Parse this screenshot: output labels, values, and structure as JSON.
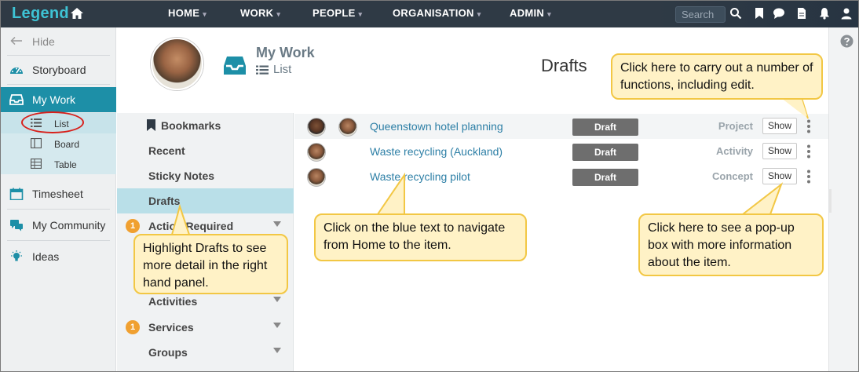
{
  "app": {
    "logo": "Legend"
  },
  "nav": {
    "items": [
      {
        "label": "HOME",
        "caret": "▾"
      },
      {
        "label": "WORK",
        "caret": "▾"
      },
      {
        "label": "PEOPLE",
        "caret": "▾"
      },
      {
        "label": "ORGANISATION",
        "caret": "▾"
      },
      {
        "label": "ADMIN",
        "caret": "▾"
      }
    ],
    "search_placeholder": "Search",
    "icons": [
      "search-icon",
      "bookmark-icon",
      "chat-icon",
      "document-icon",
      "bell-icon",
      "user-icon"
    ]
  },
  "sidebar": {
    "hide": "Hide",
    "items": [
      {
        "label": "Storyboard",
        "icon": "dashboard-icon"
      },
      {
        "label": "My Work",
        "icon": "inbox-icon"
      },
      {
        "label": "Timesheet",
        "icon": "calendar-icon"
      },
      {
        "label": "My Community",
        "icon": "chat-icon"
      },
      {
        "label": "Ideas",
        "icon": "lightbulb-icon"
      }
    ],
    "sub_items": [
      {
        "label": "List",
        "icon": "list-icon"
      },
      {
        "label": "Board",
        "icon": "board-icon"
      },
      {
        "label": "Table",
        "icon": "table-icon"
      }
    ]
  },
  "header": {
    "title": "My Work",
    "view": "List",
    "page_title": "Drafts"
  },
  "mid_menu": {
    "items": [
      {
        "label": "Bookmarks"
      },
      {
        "label": "Recent"
      },
      {
        "label": "Sticky Notes"
      },
      {
        "label": "Drafts"
      },
      {
        "label": "Action Required",
        "badge": "1"
      },
      {
        "label": "Activities"
      },
      {
        "label": "Services",
        "badge": "1"
      },
      {
        "label": "Groups"
      }
    ]
  },
  "drafts": {
    "rows": [
      {
        "title": "Queenstown hotel planning",
        "status": "Draft",
        "type": "Project",
        "show": "Show"
      },
      {
        "title": "Waste recycling (Auckland)",
        "status": "Draft",
        "type": "Activity",
        "show": "Show"
      },
      {
        "title": "Waste recycling pilot",
        "status": "Draft",
        "type": "Concept",
        "show": "Show"
      }
    ]
  },
  "callouts": {
    "functions": "Click here to carry out a number of functions, including edit.",
    "drafts": "Highlight Drafts to see more detail in the right hand panel.",
    "blue_text": "Click on the blue text to navigate from Home to the item.",
    "show_popup": "Click here to see a pop-up box with more information about the item."
  },
  "colors": {
    "topbar": "#2f3a45",
    "logo": "#3ec3d5",
    "sidebar_active": "#1d8fa7",
    "sub_active": "#c7e3ea",
    "link": "#2d7fa6",
    "badge": "#f0a030",
    "callout_fill": "#fff2c6",
    "callout_border": "#f2c744",
    "highlight_ring": "#d8201b"
  }
}
